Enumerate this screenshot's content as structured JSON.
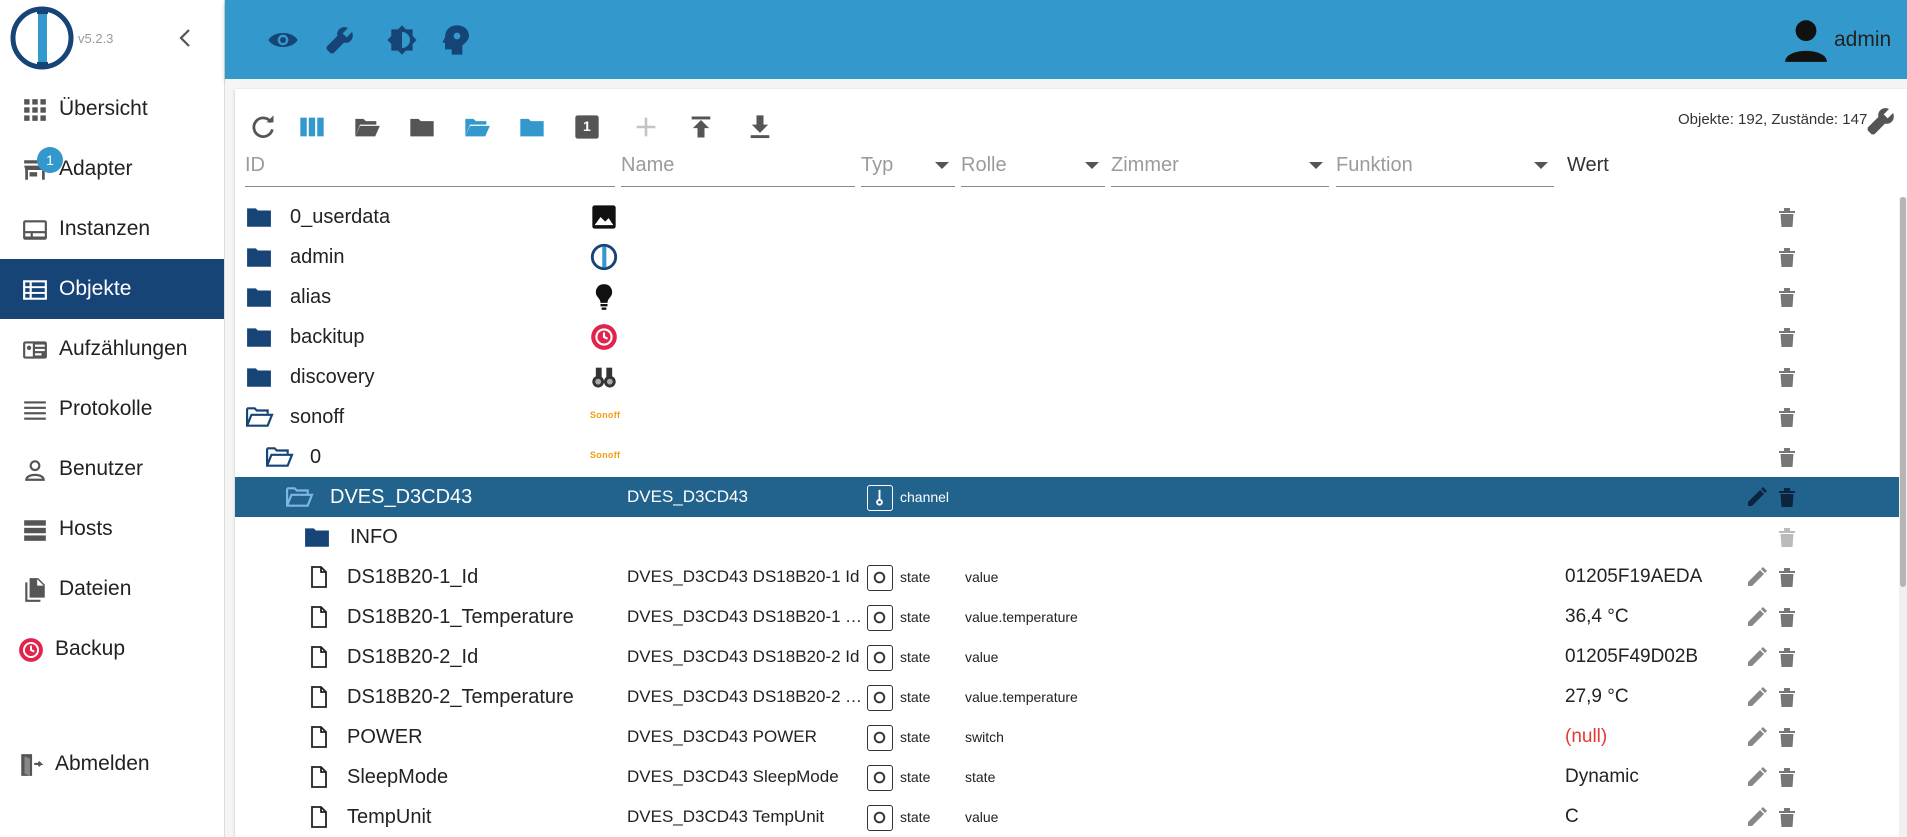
{
  "app": {
    "version": "v5.2.3"
  },
  "sidebar": {
    "items": [
      {
        "label": "Übersicht",
        "icon": "grid-icon"
      },
      {
        "label": "Adapter",
        "icon": "store-icon",
        "badge": "1"
      },
      {
        "label": "Instanzen",
        "icon": "instances-icon"
      },
      {
        "label": "Objekte",
        "icon": "list-icon",
        "active": true
      },
      {
        "label": "Aufzählungen",
        "icon": "enum-icon"
      },
      {
        "label": "Protokolle",
        "icon": "log-icon"
      },
      {
        "label": "Benutzer",
        "icon": "user-icon"
      },
      {
        "label": "Hosts",
        "icon": "hosts-icon"
      },
      {
        "label": "Dateien",
        "icon": "files-icon"
      },
      {
        "label": "Backup",
        "icon": "backup-icon"
      }
    ],
    "logout_label": "Abmelden"
  },
  "header": {
    "user_name": "admin"
  },
  "toolbar": {
    "stats": "Objekte: 192, Zustände: 147",
    "depth_label": "1"
  },
  "filters": {
    "id_placeholder": "ID",
    "name_placeholder": "Name",
    "typ": "Typ",
    "rolle": "Rolle",
    "zimmer": "Zimmer",
    "funktion": "Funktion",
    "wert": "Wert"
  },
  "rows": [
    {
      "id": "0_userdata",
      "name": "",
      "type": "",
      "role": "",
      "value": ""
    },
    {
      "id": "admin",
      "name": "",
      "type": "",
      "role": "",
      "value": ""
    },
    {
      "id": "alias",
      "name": "",
      "type": "",
      "role": "",
      "value": ""
    },
    {
      "id": "backitup",
      "name": "",
      "type": "",
      "role": "",
      "value": ""
    },
    {
      "id": "discovery",
      "name": "",
      "type": "",
      "role": "",
      "value": ""
    },
    {
      "id": "sonoff",
      "name": "",
      "type": "",
      "role": "",
      "value": "",
      "logo_text": "Sonoff"
    },
    {
      "id": "0",
      "name": "",
      "type": "",
      "role": "",
      "value": "",
      "logo_text": "Sonoff"
    },
    {
      "id": "DVES_D3CD43",
      "name": "DVES_D3CD43",
      "type": "channel",
      "role": "",
      "value": ""
    },
    {
      "id": "INFO",
      "name": "",
      "type": "",
      "role": "",
      "value": ""
    },
    {
      "id": "DS18B20-1_Id",
      "name": "DVES_D3CD43 DS18B20-1 Id",
      "type": "state",
      "role": "value",
      "value": "01205F19AEDA"
    },
    {
      "id": "DS18B20-1_Temperature",
      "name": "DVES_D3CD43 DS18B20-1 Te...",
      "type": "state",
      "role": "value.temperature",
      "value": "36,4 °C"
    },
    {
      "id": "DS18B20-2_Id",
      "name": "DVES_D3CD43 DS18B20-2 Id",
      "type": "state",
      "role": "value",
      "value": "01205F49D02B"
    },
    {
      "id": "DS18B20-2_Temperature",
      "name": "DVES_D3CD43 DS18B20-2 Te...",
      "type": "state",
      "role": "value.temperature",
      "value": "27,9 °C"
    },
    {
      "id": "POWER",
      "name": "DVES_D3CD43 POWER",
      "type": "state",
      "role": "switch",
      "value": "(null)"
    },
    {
      "id": "SleepMode",
      "name": "DVES_D3CD43 SleepMode",
      "type": "state",
      "role": "state",
      "value": "Dynamic"
    },
    {
      "id": "TempUnit",
      "name": "DVES_D3CD43 TempUnit",
      "type": "state",
      "role": "value",
      "value": "C"
    }
  ]
}
